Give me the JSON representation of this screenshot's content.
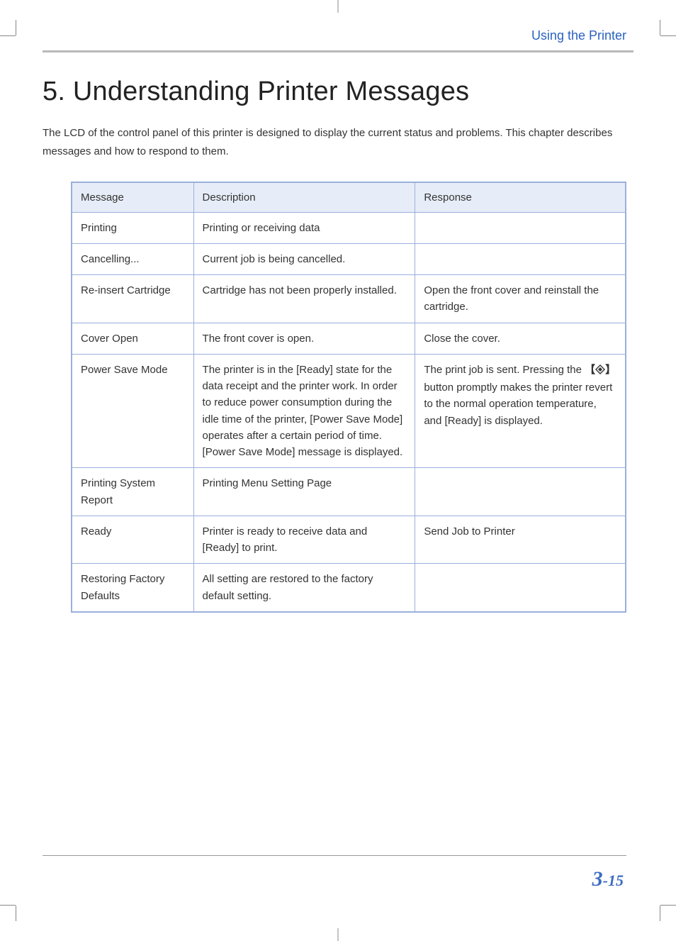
{
  "running_head": "Using the Printer",
  "chapter": {
    "number": "5.",
    "title": "Understanding Printer Messages"
  },
  "intro": "The LCD of the control panel of this printer is designed to display the current status and problems. This chapter describes messages and how to respond to them.",
  "table": {
    "headers": {
      "message": "Message",
      "description": "Description",
      "response": "Response"
    },
    "rows": [
      {
        "message": "Printing",
        "description": "Printing or receiving data",
        "response": ""
      },
      {
        "message": "Cancelling...",
        "description": "Current job is being cancelled.",
        "response": ""
      },
      {
        "message": "Re-insert Cartridge",
        "description": "Cartridge has not been properly installed.",
        "response": "Open the front cover and reinstall the cartridge."
      },
      {
        "message": "Cover Open",
        "description": "The front cover is open.",
        "response": "Close the cover."
      },
      {
        "message": "Power Save Mode",
        "description": "The printer is in the [Ready] state for the data receipt and the printer work. In order to reduce power consumption during the idle time of the printer, [Power Save Mode] operates after a certain period of time. [Power Save Mode] message is displayed.",
        "response_pre": "The print job is sent. Pressing the ",
        "response_post": " button promptly makes the printer revert to the normal operation temperature, and [Ready] is displayed.",
        "has_icon": true
      },
      {
        "message": "Printing System Report",
        "description": "Printing Menu Setting Page",
        "response": ""
      },
      {
        "message": "Ready",
        "description": "Printer is ready to receive data and [Ready] to print.",
        "response": "Send Job to Printer"
      },
      {
        "message": "Restoring Factory Defaults",
        "description": "All setting are restored to the factory default setting.",
        "response": ""
      }
    ]
  },
  "page_number": {
    "chapter": "3",
    "sep": "-",
    "page": "15"
  }
}
